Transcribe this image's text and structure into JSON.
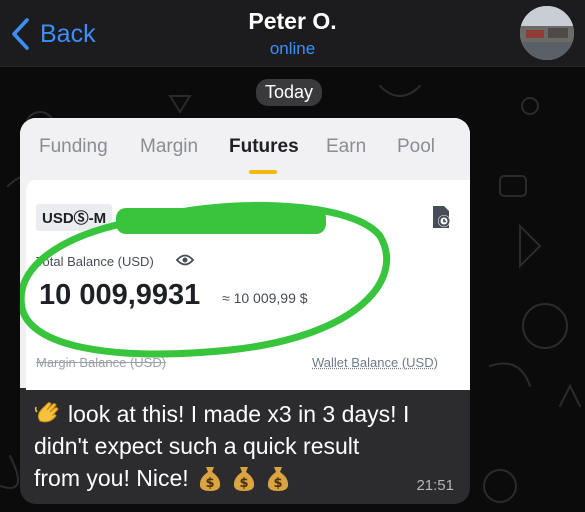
{
  "header": {
    "back_label": "Back",
    "contact_name": "Peter O.",
    "contact_status": "online"
  },
  "date_separator": "Today",
  "screenshot": {
    "tabs": [
      "Funding",
      "Margin",
      "Futures",
      "Earn",
      "Pool"
    ],
    "active_tab": "Futures",
    "asset_pill": "USDⓈ-M",
    "total_balance_label": "Total Balance (USD)",
    "total_balance_value": "10 009,9931",
    "approx_value": "≈ 10 009,99 $",
    "margin_balance_label": "Margin Balance (USD)",
    "wallet_balance_label": "Wallet Balance (USD)",
    "accent_color": "#f0b90b",
    "highlight_color": "#38c43c"
  },
  "message": {
    "line1": "look at this! I made x3 in 3 days! I",
    "line2": "didn't expect such a quick result",
    "line3": "from you! Nice!",
    "time": "21:51",
    "emojis": [
      "waving-hand-icon",
      "money-bag-icon",
      "money-bag-icon",
      "money-bag-icon"
    ]
  }
}
